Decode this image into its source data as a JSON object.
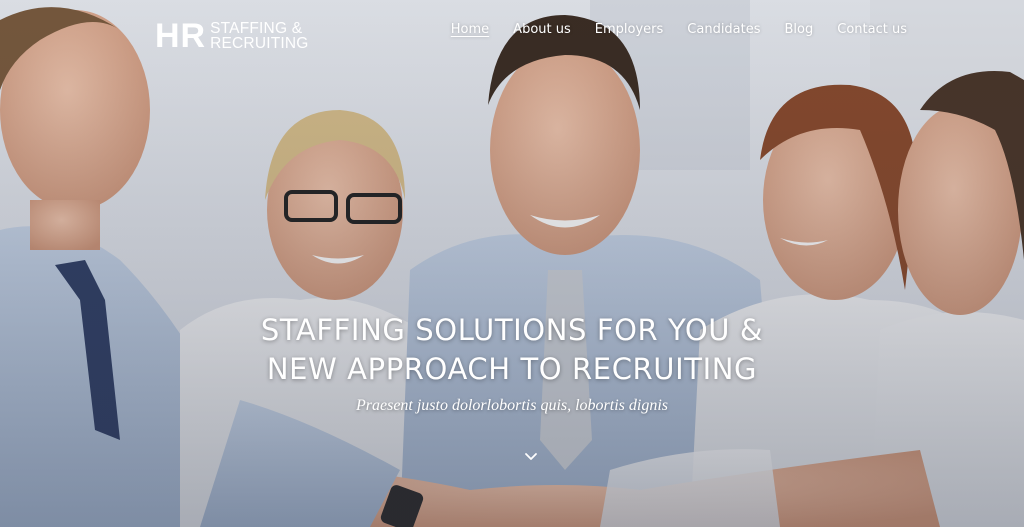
{
  "header": {
    "logo": {
      "mark": "HR",
      "line1": "STAFFING &",
      "line2": "RECRUITING"
    },
    "nav": [
      {
        "label": "Home",
        "active": true
      },
      {
        "label": "About us",
        "active": false
      },
      {
        "label": "Employers",
        "active": false
      },
      {
        "label": "Candidates",
        "active": false
      },
      {
        "label": "Blog",
        "active": false
      },
      {
        "label": "Contact us",
        "active": false
      }
    ]
  },
  "hero": {
    "headline_line1": "STAFFING SOLUTIONS FOR YOU &",
    "headline_line2": "NEW APPROACH TO RECRUITING",
    "tagline": "Praesent justo dolorlobortis quis, lobortis dignis",
    "scroll_icon": "chevron-down-icon"
  },
  "colors": {
    "text": "#ffffff",
    "shirt": "#b9c9df",
    "skin": "#e6b59a",
    "background": "#e3e7ee"
  }
}
